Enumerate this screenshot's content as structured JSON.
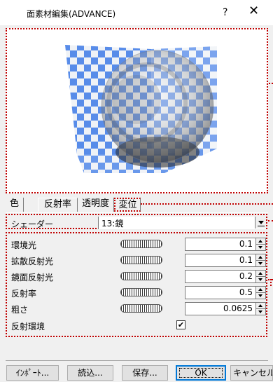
{
  "window": {
    "title": "面素材編集(ADVANCE)",
    "help_label": "?",
    "close_label": "✕"
  },
  "tabs": [
    {
      "label": "色",
      "active": false
    },
    {
      "label": "反射率",
      "active": true
    },
    {
      "label": "透明度",
      "active": false
    },
    {
      "label": "変位",
      "active": false
    }
  ],
  "shader": {
    "label": "シェーダー",
    "value": "13:鏡"
  },
  "params": [
    {
      "label": "環境光",
      "value": "0.1"
    },
    {
      "label": "拡散反射光",
      "value": "0.1"
    },
    {
      "label": "鏡面反射光",
      "value": "0.2"
    },
    {
      "label": "反射率",
      "value": "0.5"
    },
    {
      "label": "粗さ",
      "value": "0.0625"
    }
  ],
  "reflection_env": {
    "label": "反射環境",
    "checked": true,
    "check_glyph": "✔"
  },
  "buttons": {
    "import": "ｲﾝﾎﾟｰﾄ...",
    "load": "読込...",
    "save": "保存...",
    "ok": "OK",
    "cancel": "キャンセル"
  },
  "colors": {
    "annotation": "#c00000",
    "checker_blue": "#4f86e8",
    "checker_light": "#eef1f6"
  }
}
